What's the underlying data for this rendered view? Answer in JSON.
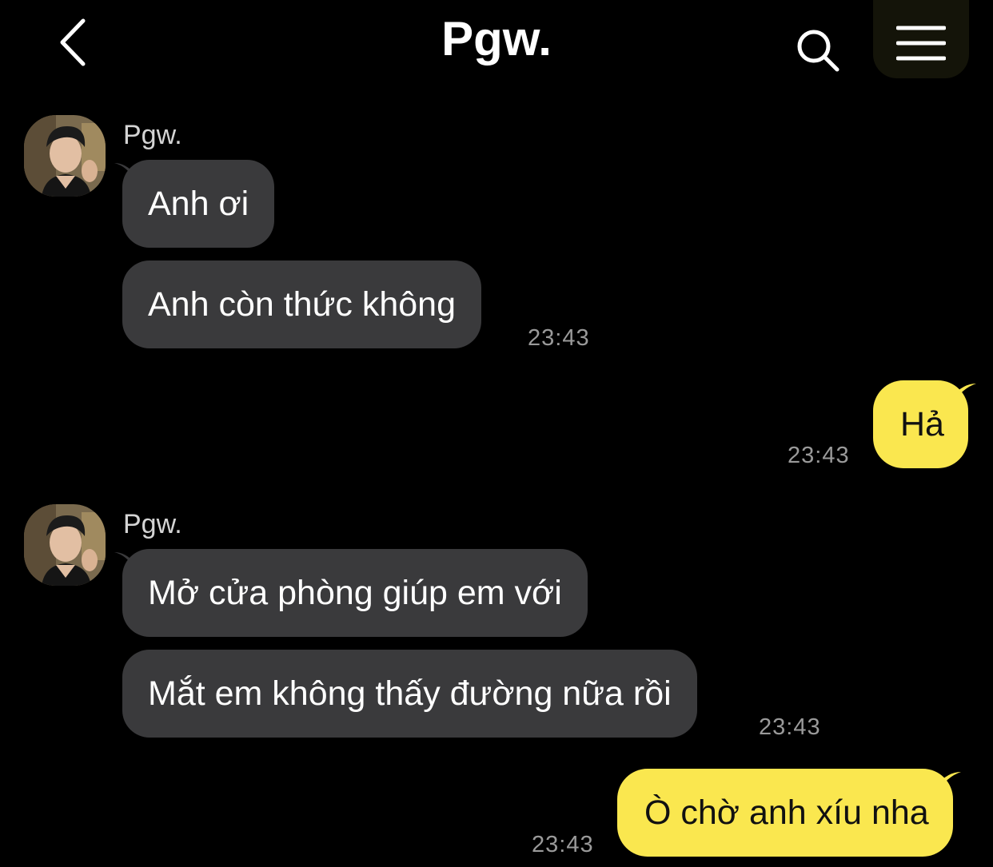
{
  "header": {
    "title": "Pgw.",
    "back_icon": "chevron-left-icon",
    "search_icon": "search-icon",
    "menu_icon": "hamburger-menu-icon"
  },
  "colors": {
    "background": "#000000",
    "incoming_bubble": "#3a3a3c",
    "outgoing_bubble": "#fae74f",
    "timestamp": "#9a9a9a"
  },
  "messages": [
    {
      "sender": "Pgw.",
      "bubbles": [
        "Anh ơi",
        "Anh còn thức không"
      ],
      "time": "23:43"
    },
    {
      "sender": "me",
      "bubbles": [
        "Hả"
      ],
      "time": "23:43"
    },
    {
      "sender": "Pgw.",
      "bubbles": [
        "Mở cửa phòng giúp em với",
        "Mắt em không thấy đường nữa rồi"
      ],
      "time": "23:43"
    },
    {
      "sender": "me",
      "bubbles": [
        "Ò chờ anh xíu nha"
      ],
      "time": "23:43"
    }
  ]
}
